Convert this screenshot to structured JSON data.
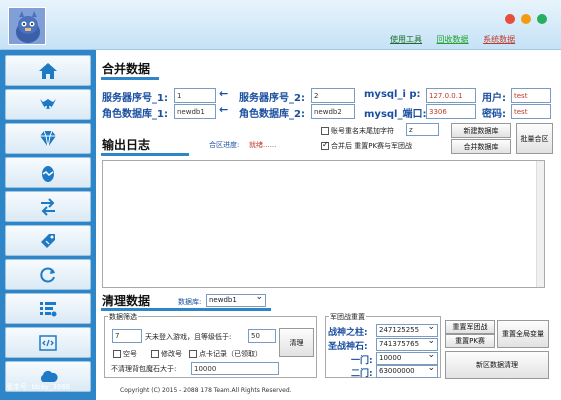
{
  "header": {
    "links": [
      "使用工具",
      "回收数据",
      "系统数据"
    ],
    "link_colors": [
      "#1b6f2a",
      "#1fa32a",
      "#c0392b"
    ],
    "dots": [
      "#e74c3c",
      "#f39c12",
      "#27ae60"
    ]
  },
  "sidebar": {
    "items": [
      {
        "icon": "home-icon"
      },
      {
        "icon": "viking-helmet-icon"
      },
      {
        "icon": "diamond-icon"
      },
      {
        "icon": "egg-icon"
      },
      {
        "icon": "transfer-arrows-icon"
      },
      {
        "icon": "tag-icon"
      },
      {
        "icon": "refresh-icon"
      },
      {
        "icon": "list-settings-icon"
      },
      {
        "icon": "code-icon"
      },
      {
        "icon": "cloud-icon"
      }
    ],
    "version_label": "版本号: bbay_3666"
  },
  "merge": {
    "title": "合并数据",
    "server_no_1_label": "服务器序号_1:",
    "server_no_1_value": "1",
    "role_db_1_label": "角色数据库_1:",
    "role_db_1_value": "newdb1",
    "server_no_2_label": "服务器序号_2:",
    "server_no_2_value": "2",
    "role_db_2_label": "角色数据库_2:",
    "role_db_2_value": "newdb2",
    "mysql_ip_label": "mysql_i p:",
    "mysql_ip_value": "127.0.0.1",
    "mysql_port_label": "mysql_端口:",
    "mysql_port_value": "3306",
    "user_label": "用户:",
    "user_value": "test",
    "password_label": "密码:",
    "password_value": "test",
    "arrow": "←"
  },
  "options": {
    "account_suffix_label": "账号重名末尾加字符",
    "account_suffix_checked": false,
    "suffix_value": "z",
    "reset_pk_label": "合并后 重置PK赛与军团战",
    "reset_pk_checked": true,
    "new_db_button": "新建数据库",
    "merge_db_button": "合并数据库",
    "batch_merge_button": "批量合区"
  },
  "log": {
    "title": "输出日志",
    "progress_label": "合区进度:",
    "progress_status": "就绪......"
  },
  "clean": {
    "title": "清理数据",
    "db_label": "数据库:",
    "db_selected": "newdb1",
    "filter_group_title": "数据筛选",
    "days_value": "7",
    "days_text": "天未登入游戏，且等级低于:",
    "level_value": "50",
    "clean_button": "清理",
    "empty_label": "空号",
    "toggle_label": "修改号",
    "point_card_label": "点卡记录（已领取）",
    "bag_label": "不清理背包魔石大于:",
    "bag_value": "10000",
    "legion_group_title": "军团战重置",
    "war_pillar_label": "战神之柱:",
    "war_pillar_value": "247125255",
    "saint_label": "圣战神石:",
    "saint_value": "741375765",
    "gate1_label": "一门:",
    "gate1_value": "10000",
    "gate2_label": "二门:",
    "gate2_value": "63000000",
    "reset_legion_button": "重置军团战",
    "reset_pk_button": "重置PK赛",
    "reset_all_button": "重置全局变量",
    "new_zone_button": "新区数据清理"
  },
  "footer": {
    "copyright": "Copyright (C) 2015 - 2088 178 Team.All Rights Reserved."
  }
}
